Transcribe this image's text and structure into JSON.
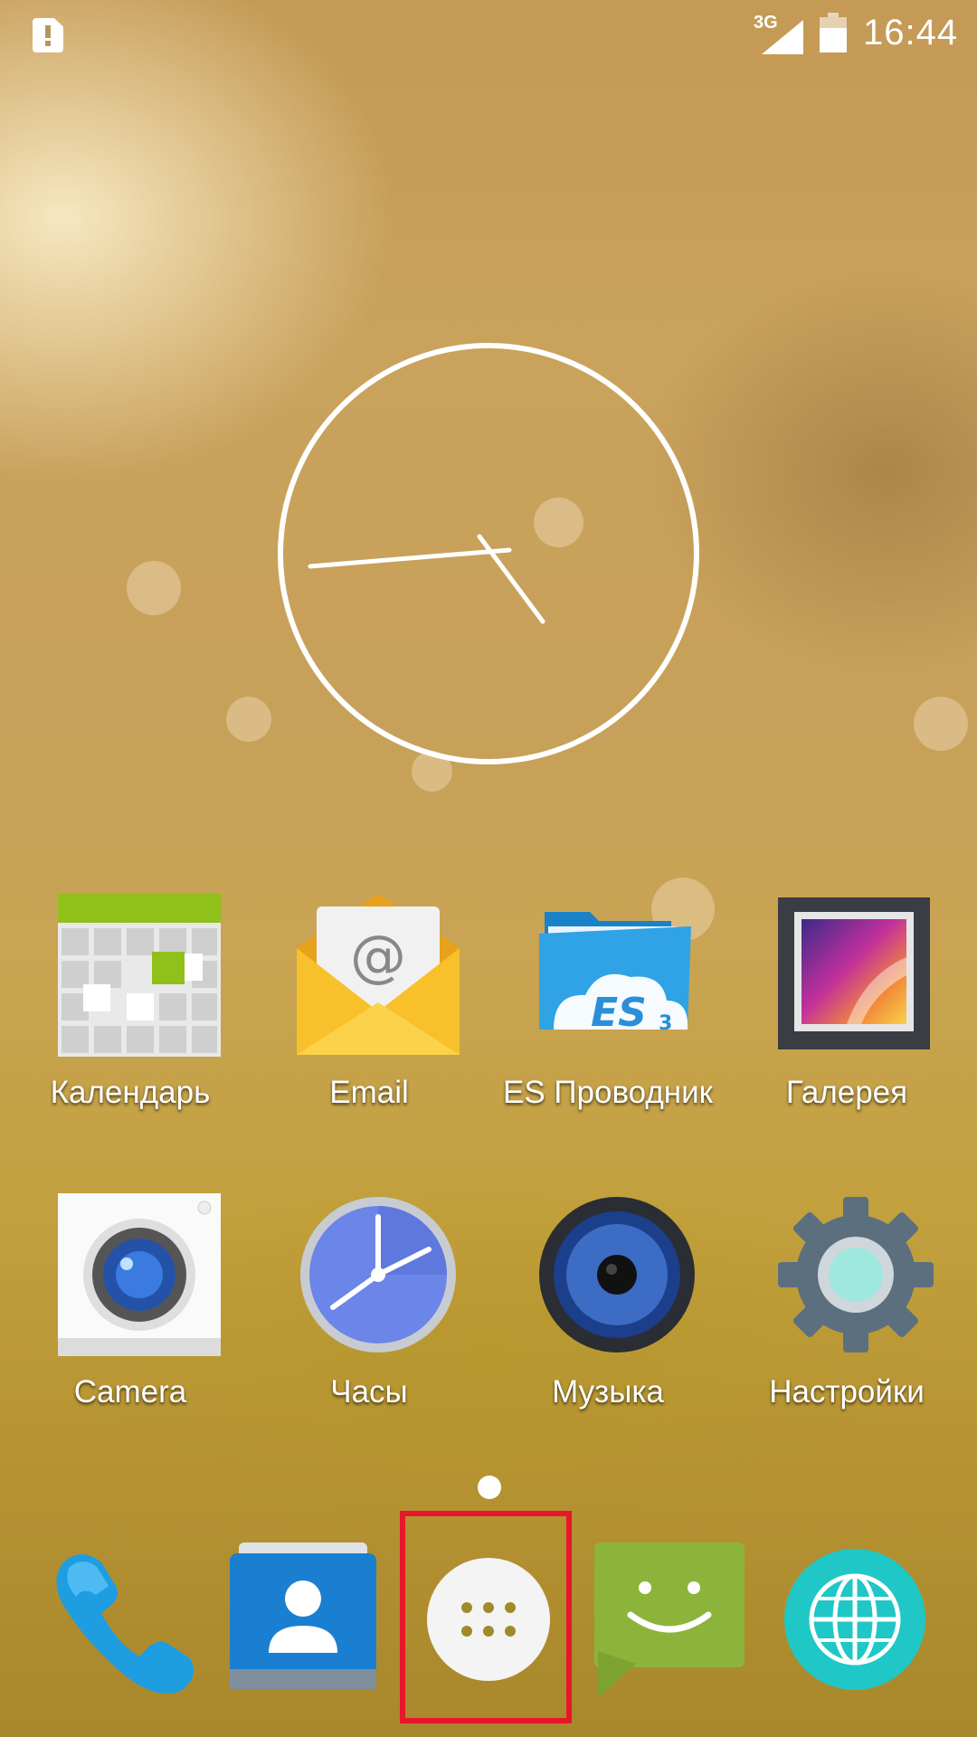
{
  "status_bar": {
    "network_type": "3G",
    "time": "16:44",
    "icons": [
      "sd-card-alert-icon",
      "signal-icon",
      "battery-icon"
    ]
  },
  "clock_widget": {
    "hour_hand_time": "16:44",
    "icon": "analog-clock-icon"
  },
  "apps": [
    {
      "label": "Календарь",
      "icon": "calendar-icon"
    },
    {
      "label": "Email",
      "icon": "email-icon"
    },
    {
      "label": "ES Проводник",
      "icon": "es-file-explorer-icon"
    },
    {
      "label": "Галерея",
      "icon": "gallery-icon"
    },
    {
      "label": "Camera",
      "icon": "camera-icon"
    },
    {
      "label": "Часы",
      "icon": "clock-app-icon"
    },
    {
      "label": "Музыка",
      "icon": "music-icon"
    },
    {
      "label": "Настройки",
      "icon": "settings-gear-icon"
    }
  ],
  "dock": [
    {
      "icon": "phone-icon"
    },
    {
      "icon": "contacts-icon"
    },
    {
      "icon": "app-drawer-icon"
    },
    {
      "icon": "messaging-icon"
    },
    {
      "icon": "browser-globe-icon"
    }
  ],
  "colors": {
    "highlight": "#e8162a",
    "calendar_green": "#8fc11a",
    "email_yellow": "#f8c12b",
    "es_blue": "#2fa3e6",
    "settings_gray": "#5b6f7f",
    "messaging_green": "#8cb43a",
    "browser_teal": "#1fc7c7",
    "contacts_blue": "#1a7fd1"
  }
}
